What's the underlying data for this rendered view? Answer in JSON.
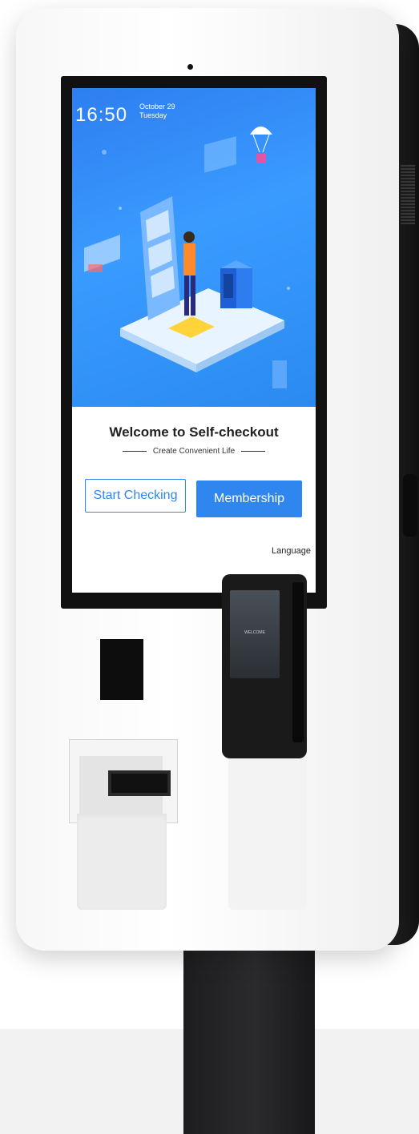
{
  "status": {
    "time": "16:50",
    "date": "October 29",
    "weekday": "Tuesday"
  },
  "welcome": {
    "title": "Welcome to Self-checkout",
    "subtitle": "Create Convenient Life"
  },
  "buttons": {
    "start": "Start Checking",
    "membership": "Membership"
  },
  "language_label": "Language",
  "card_reader": {
    "screen_text": "WELCOME"
  },
  "colors": {
    "accent": "#2f86ee",
    "hero_bg": "#3a9bff",
    "kiosk_body": "#ffffff"
  }
}
